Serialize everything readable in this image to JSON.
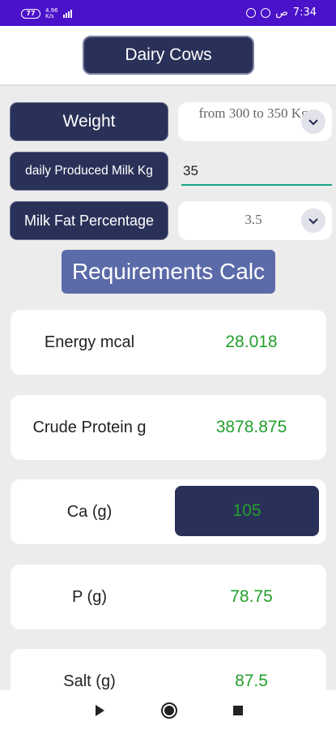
{
  "status_bar": {
    "battery": "77",
    "network_speed": "4.96",
    "network_unit": "K/s",
    "time": "7:34",
    "ampm": "ص"
  },
  "header": {
    "title": "Dairy Cows"
  },
  "form": {
    "weight": {
      "label": "Weight",
      "value": "from 300 to 350 Kg"
    },
    "milk": {
      "label": "daily Produced Milk Kg",
      "value": "35"
    },
    "fat": {
      "label": "Milk Fat Percentage",
      "value": "3.5"
    },
    "calc_button": "Requirements Calc"
  },
  "results": [
    {
      "label": "Energy mcal",
      "value": "28.018"
    },
    {
      "label": "Crude Protein g",
      "value": "3878.875"
    },
    {
      "label": "Ca (g)",
      "value": "105"
    },
    {
      "label": "P (g)",
      "value": "78.75"
    },
    {
      "label": "Salt (g)",
      "value": "87.5"
    }
  ],
  "colors": {
    "primary": "#2a3158",
    "accent": "#5b6aa8",
    "value_green": "#23a02c",
    "status_bar": "#4a12c9"
  },
  "icons": {
    "dropdown": "chevron-down-icon",
    "nav_back": "back-triangle-icon",
    "nav_home": "home-circle-icon",
    "nav_recent": "recent-square-icon"
  }
}
